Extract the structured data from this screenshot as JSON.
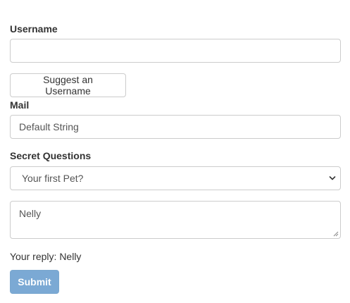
{
  "form": {
    "username": {
      "label": "Username",
      "value": "",
      "placeholder": ""
    },
    "suggest_button": "Suggest an Username",
    "mail": {
      "label": "Mail",
      "value": "Default String"
    },
    "secret": {
      "label": "Secret Questions",
      "selected": "Your first Pet?",
      "answer": "Nelly"
    },
    "reply": {
      "prefix": "Your reply:",
      "value": "Nelly"
    },
    "submit_label": "Submit"
  },
  "colors": {
    "border": "#cccccc",
    "primary": "#7ba9d4",
    "text": "#333333",
    "input_text": "#555555"
  }
}
